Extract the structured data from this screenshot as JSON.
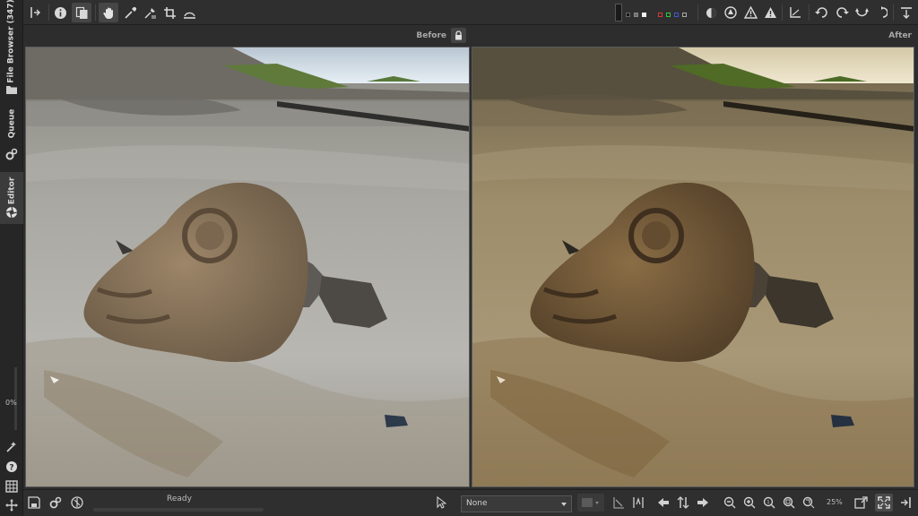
{
  "sidebar": {
    "tabs": [
      {
        "label": "File Browser (347)"
      },
      {
        "label": "Queue"
      },
      {
        "label": "Editor"
      }
    ],
    "progress_label": "0%"
  },
  "panels": {
    "before_label": "Before",
    "after_label": "After"
  },
  "statusbar": {
    "status_text": "Ready",
    "preview_select": "None",
    "zoom": "25%"
  },
  "colors": {
    "accent": "#3b3b3b",
    "background": "#2d2d2d"
  }
}
